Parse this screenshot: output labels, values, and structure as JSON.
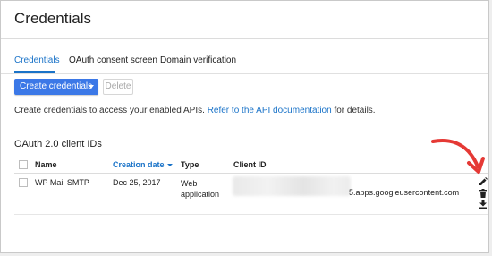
{
  "header": {
    "title": "Credentials"
  },
  "tabs": [
    {
      "label": "Credentials"
    },
    {
      "label": "OAuth consent screen"
    },
    {
      "label": "Domain verification"
    }
  ],
  "toolbar": {
    "create_label": "Create credentials",
    "delete_label": "Delete"
  },
  "description": {
    "text": "Create credentials to access your enabled APIs. ",
    "link": "Refer to the API documentation",
    "suffix": " for details."
  },
  "section": {
    "title": "OAuth 2.0 client IDs"
  },
  "table": {
    "columns": [
      "Name",
      "Creation date",
      "Type",
      "Client ID"
    ],
    "rows": [
      {
        "name": "WP Mail SMTP",
        "date": "Dec 25, 2017",
        "type": "Web application",
        "client_id_visible": "5.apps.googleusercontent.com"
      }
    ]
  },
  "icons": [
    "pencil-icon",
    "trash-icon",
    "download-icon",
    "arrow-annotation"
  ],
  "colors": {
    "accent": "#1a73c8",
    "primary_button": "#3b78e7",
    "annotation": "#e53935"
  }
}
